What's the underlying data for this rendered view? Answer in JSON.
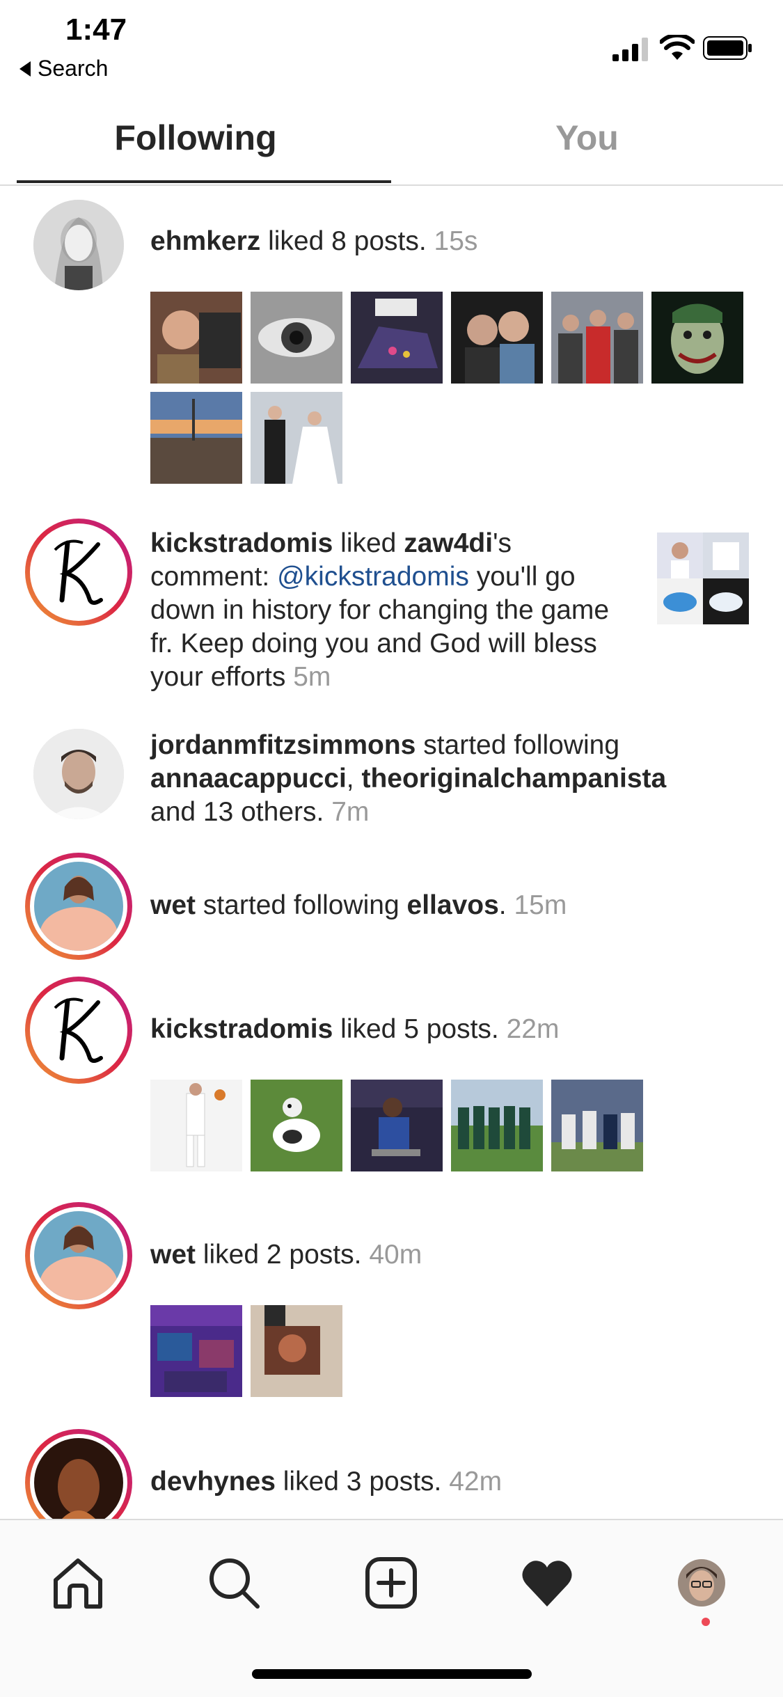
{
  "status_bar": {
    "time": "1:47",
    "back_label": "Search"
  },
  "tabs": [
    {
      "label": "Following",
      "active": true
    },
    {
      "label": "You",
      "active": false
    }
  ],
  "feed": {
    "item1": {
      "user": "ehmkerz",
      "action": " liked 8 posts. ",
      "time": "15s",
      "thumb_count": 8
    },
    "item2": {
      "user": "kickstradomis",
      "action_a": " liked ",
      "target": "zaw4di",
      "action_b": "'s comment: ",
      "mention": "@kickstradomis",
      "comment": " you'll go down in history for changing the game fr. Keep doing you and God will bless your efforts ",
      "time": "5m"
    },
    "item3": {
      "user": "jordanmfitzsimmons",
      "action": " started following ",
      "target1": "annaacappucci",
      "sep": ", ",
      "target2": "theoriginalchampanista",
      "tail": " and 13 others. ",
      "time": "7m"
    },
    "item4": {
      "user": "wet",
      "action": " started following ",
      "target": "ellavos",
      "dot": ". ",
      "time": "15m"
    },
    "item5": {
      "user": "kickstradomis",
      "action": " liked 5 posts. ",
      "time": "22m",
      "thumb_count": 5
    },
    "item6": {
      "user": "wet",
      "action": " liked 2 posts. ",
      "time": "40m",
      "thumb_count": 2
    },
    "item7": {
      "user": "devhynes",
      "action": " liked 3 posts. ",
      "time": "42m"
    }
  },
  "tab_bar": {
    "icons": [
      "home-icon",
      "search-icon",
      "new-post-icon",
      "activity-heart-icon",
      "profile-avatar"
    ],
    "notification_dot_color": "#ed4956"
  },
  "colors": {
    "text": "#262626",
    "muted": "#999999",
    "mention": "#1f4f8f",
    "ring_start": "#f09433",
    "ring_end": "#bc1888"
  }
}
